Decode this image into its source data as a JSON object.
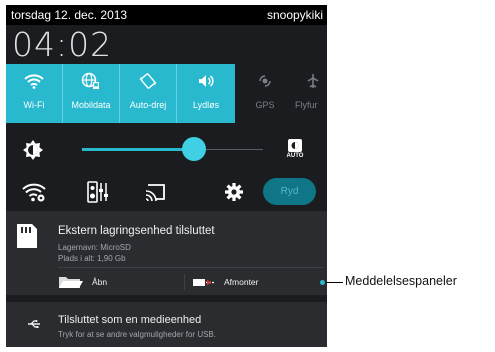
{
  "status_bar": {
    "date": "torsdag 12. dec. 2013",
    "user": "snoopykiki"
  },
  "clock": "04:02",
  "quick_settings": [
    {
      "label": "Wi-Fi",
      "icon": "wifi-icon",
      "active": true
    },
    {
      "label": "Mobildata",
      "icon": "globe-icon",
      "active": true
    },
    {
      "label": "Auto-drej",
      "icon": "rotate-icon",
      "active": true
    },
    {
      "label": "Lydløs",
      "icon": "volume-icon",
      "active": true
    },
    {
      "label": "GPS",
      "icon": "gps-icon",
      "active": false
    },
    {
      "label": "Flyfur",
      "icon": "airplane-icon",
      "active": false
    }
  ],
  "brightness": {
    "level": 0.55,
    "auto_label": "AUTO"
  },
  "toggles": {
    "clear_label": "Ryd"
  },
  "notifications": [
    {
      "title": "Ekstern lagringsenhed tilsluttet",
      "lines": [
        "Lagernavn: MicroSD",
        "Plads i alt: 1,90 Gb"
      ],
      "actions": [
        {
          "label": "Åbn",
          "icon": "folder-icon"
        },
        {
          "label": "Afmonter",
          "icon": "eject-icon"
        }
      ]
    },
    {
      "title": "Tilsluttet som en medieenhed",
      "lines": [
        "Tryk for at se andre valgmuligheder for USB."
      ]
    }
  ],
  "callout": "Meddelelsespaneler",
  "colors": {
    "accent": "#28b9cf",
    "panel": "#1b1c20",
    "notification": "#2a2c30"
  }
}
